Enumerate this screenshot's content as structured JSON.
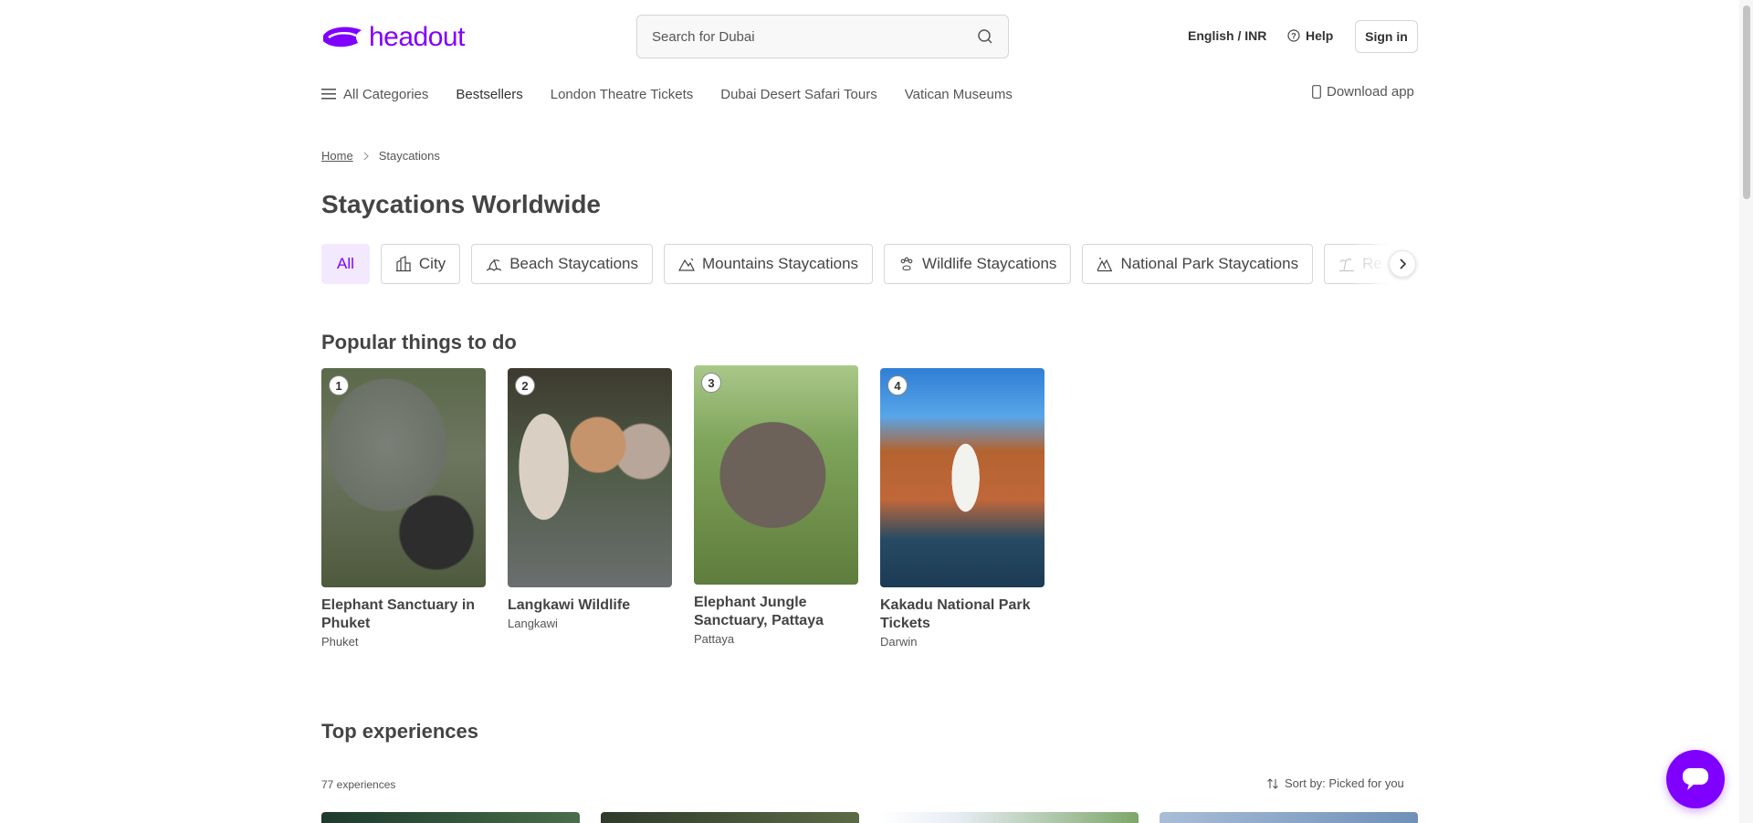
{
  "brand": {
    "name": "headout",
    "color": "#8000ff"
  },
  "search": {
    "placeholder": "Search for Dubai"
  },
  "header": {
    "language_currency": "English / INR",
    "help_label": "Help",
    "signin_label": "Sign in"
  },
  "nav": {
    "all_categories": "All Categories",
    "items": [
      "Bestsellers",
      "London Theatre Tickets",
      "Dubai Desert Safari Tours",
      "Vatican Museums"
    ],
    "download_app": "Download app"
  },
  "breadcrumb": {
    "home": "Home",
    "current": "Staycations"
  },
  "page_title": "Staycations Worldwide",
  "chips": [
    {
      "label": "All",
      "icon": "none",
      "active": true
    },
    {
      "label": "City",
      "icon": "city-icon",
      "active": false
    },
    {
      "label": "Beach Staycations",
      "icon": "beach-icon",
      "active": false
    },
    {
      "label": "Mountains Staycations",
      "icon": "mountain-icon",
      "active": false
    },
    {
      "label": "Wildlife Staycations",
      "icon": "paw-icon",
      "active": false
    },
    {
      "label": "National Park Staycations",
      "icon": "park-icon",
      "active": false
    },
    {
      "label": "Re",
      "icon": "palm-icon",
      "active": false
    }
  ],
  "popular": {
    "title": "Popular things to do",
    "cards": [
      {
        "rank": "1",
        "title": "Elephant Sanctuary in Phuket",
        "location": "Phuket"
      },
      {
        "rank": "2",
        "title": "Langkawi Wildlife",
        "location": "Langkawi"
      },
      {
        "rank": "3",
        "title": "Elephant Jungle Sanctuary, Pattaya",
        "location": "Pattaya"
      },
      {
        "rank": "4",
        "title": "Kakadu National Park Tickets",
        "location": "Darwin"
      }
    ]
  },
  "top_experiences": {
    "title": "Top experiences",
    "count": "77 experiences",
    "sort_label": "Sort by: Picked for you"
  }
}
